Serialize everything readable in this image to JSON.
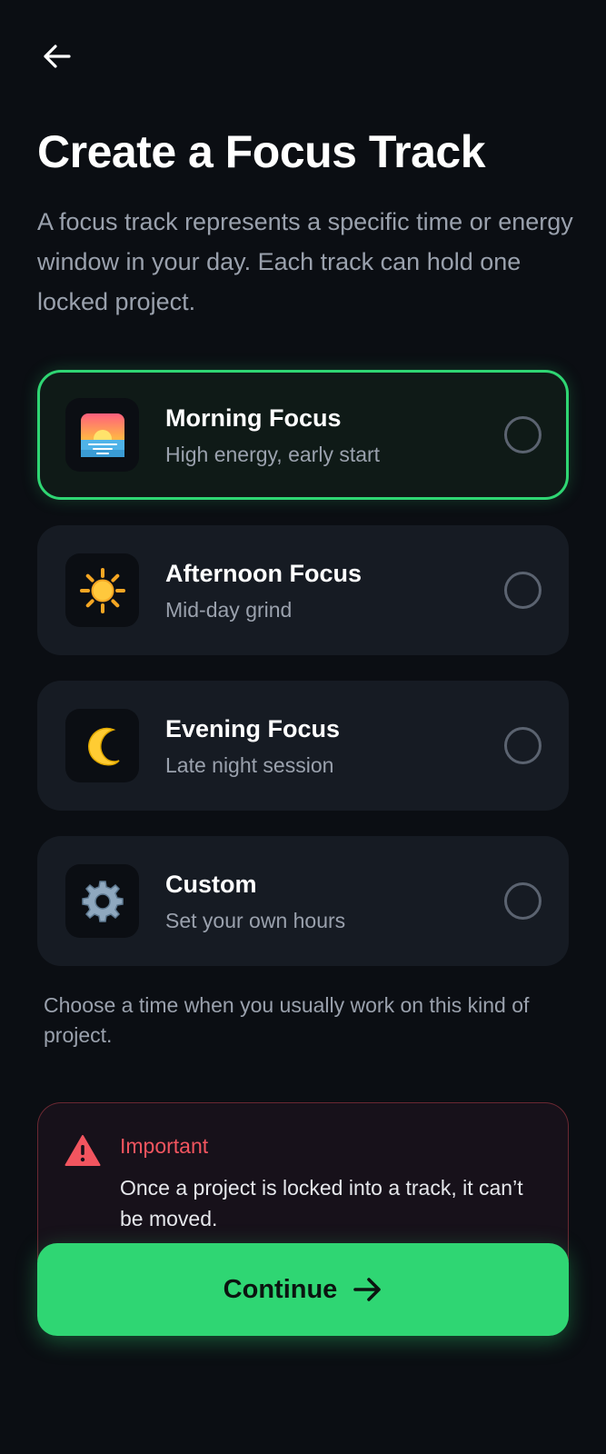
{
  "header": {
    "back_icon": "arrow-left-icon",
    "title": "Create a Focus Track",
    "subtitle": "A focus track represents a specific time or energy window in your day. Each track can hold one locked project."
  },
  "tracks": [
    {
      "name": "Morning Focus",
      "description": "High energy, early start",
      "icon": "sunrise-icon",
      "selected": true
    },
    {
      "name": "Afternoon Focus",
      "description": "Mid-day grind",
      "icon": "sun-icon",
      "selected": false
    },
    {
      "name": "Evening Focus",
      "description": "Late night session",
      "icon": "moon-icon",
      "selected": false
    },
    {
      "name": "Custom",
      "description": "Set your own hours",
      "icon": "gear-icon",
      "selected": false
    }
  ],
  "helper_text": "Choose a time when you usually work on this kind of project.",
  "alert": {
    "icon": "warning-icon",
    "title": "Important",
    "body": "Once a project is locked into a track, it can’t be moved."
  },
  "continue_button": {
    "label": "Continue",
    "icon": "arrow-right-icon"
  },
  "colors": {
    "background": "#0b0e13",
    "card": "#161b23",
    "accent": "#2fd673",
    "warning": "#f2555f",
    "muted_text": "#9aa1ad"
  }
}
